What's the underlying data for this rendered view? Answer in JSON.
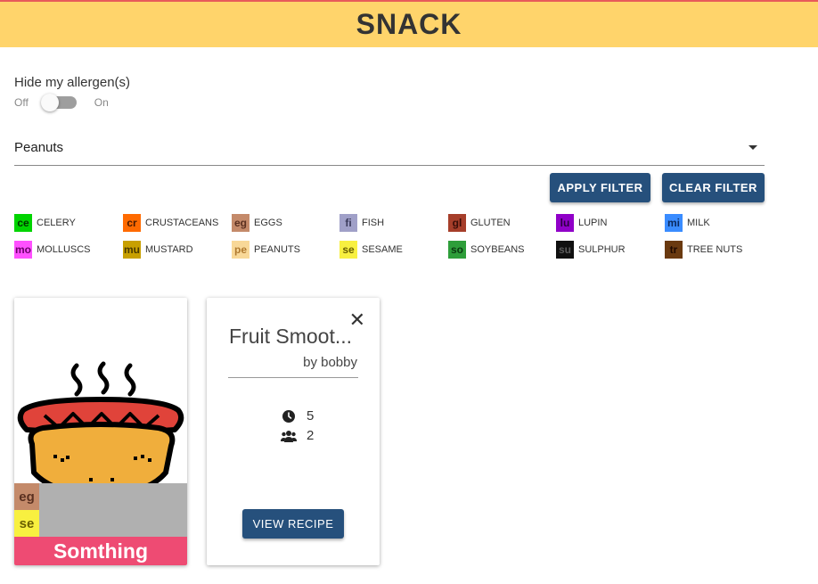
{
  "header": {
    "title": "SNACK"
  },
  "filter": {
    "hide_label": "Hide my allergen(s)",
    "toggle_off": "Off",
    "toggle_on": "On",
    "toggle_state": false,
    "selected_allergen": "Peanuts",
    "apply_label": "APPLY FILTER",
    "clear_label": "CLEAR FILTER"
  },
  "legend": [
    {
      "code": "ce",
      "name": "CELERY",
      "bg": "#00d400",
      "fg": "#003300"
    },
    {
      "code": "cr",
      "name": "CRUSTACEANS",
      "bg": "#ff6a00",
      "fg": "#4a1a00"
    },
    {
      "code": "eg",
      "name": "EGGS",
      "bg": "#c48a6a",
      "fg": "#5a3020"
    },
    {
      "code": "fi",
      "name": "FISH",
      "bg": "#a0a0c8",
      "fg": "#3a3a5a"
    },
    {
      "code": "gl",
      "name": "GLUTEN",
      "bg": "#a63e2a",
      "fg": "#3a0e08"
    },
    {
      "code": "lu",
      "name": "LUPIN",
      "bg": "#9000c8",
      "fg": "#2a0040"
    },
    {
      "code": "mi",
      "name": "MILK",
      "bg": "#3a8cff",
      "fg": "#0a2a60"
    },
    {
      "code": "mo",
      "name": "MOLLUSCS",
      "bg": "#ff50ff",
      "fg": "#6a006a"
    },
    {
      "code": "mu",
      "name": "MUSTARD",
      "bg": "#c8a000",
      "fg": "#4a3a00"
    },
    {
      "code": "pe",
      "name": "PEANUTS",
      "bg": "#f8d898",
      "fg": "#b07a30"
    },
    {
      "code": "se",
      "name": "SESAME",
      "bg": "#f8f040",
      "fg": "#6a6000"
    },
    {
      "code": "so",
      "name": "SOYBEANS",
      "bg": "#2e9e3a",
      "fg": "#0a3a10"
    },
    {
      "code": "su",
      "name": "SULPHUR",
      "bg": "#101010",
      "fg": "#5a5a5a"
    },
    {
      "code": "tr",
      "name": "TREE NUTS",
      "bg": "#6a3a10",
      "fg": "#200a00"
    }
  ],
  "cards": {
    "snack": {
      "title": "Somthing",
      "allergens": [
        {
          "code": "eg",
          "bg": "#c48a6a",
          "fg": "#5a3020"
        },
        {
          "code": "se",
          "bg": "#f8f040",
          "fg": "#6a6000"
        }
      ],
      "image_icon": "hotdog-icon"
    },
    "recipe": {
      "title": "Fruit Smoot...",
      "author": "by bobby",
      "time": "5",
      "servings": "2",
      "time_icon": "clock-icon",
      "servings_icon": "users-icon",
      "close_icon": "close-icon",
      "view_label": "VIEW RECIPE"
    }
  },
  "colors": {
    "header_bg": "#ffd46b",
    "button_bg": "#26507c",
    "card_title_bg": "#ee4b73"
  }
}
